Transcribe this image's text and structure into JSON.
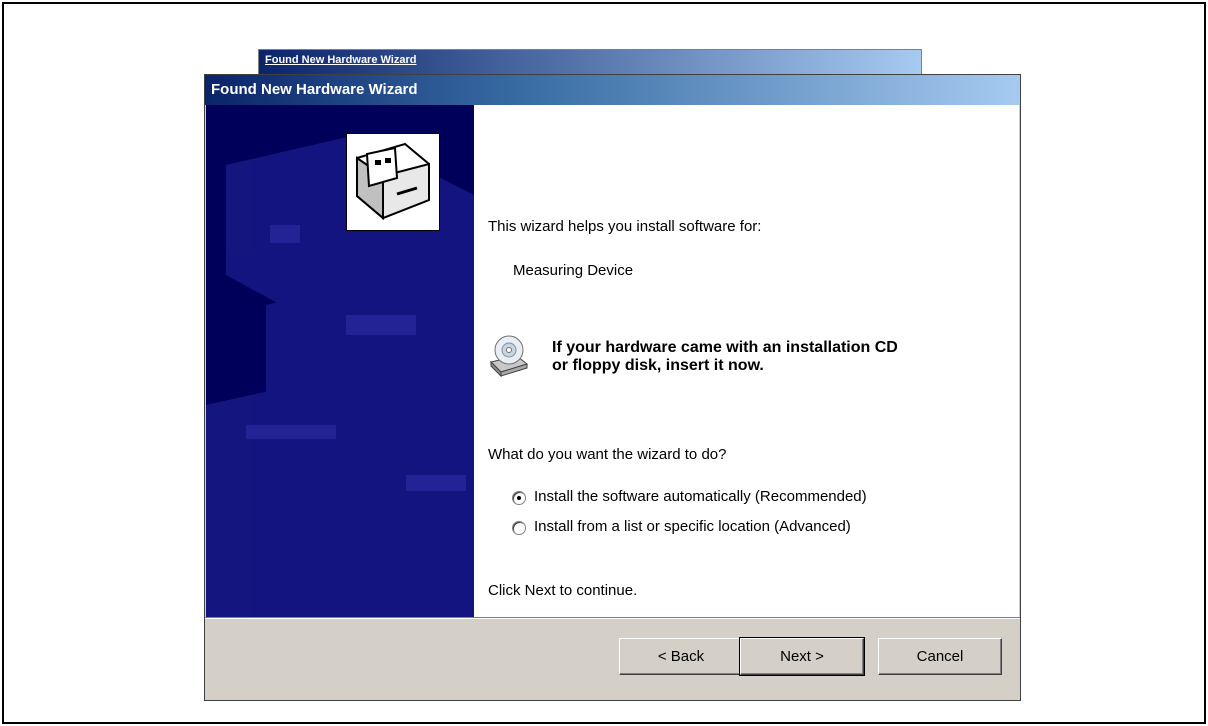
{
  "back_window": {
    "title": "Found New Hardware Wizard"
  },
  "window": {
    "title": "Found New Hardware Wizard"
  },
  "content": {
    "intro": "This wizard helps you install software for:",
    "device_name": "Measuring Device",
    "cd_notice_line1": "If your hardware came with an installation CD",
    "cd_notice_line2": "or floppy disk, insert it now.",
    "question": "What do you want the wizard to do?",
    "options": [
      {
        "label": "Install the software automatically (Recommended)",
        "selected": true
      },
      {
        "label": "Install from a list or specific location (Advanced)",
        "selected": false
      }
    ],
    "footer_hint": "Click Next to continue."
  },
  "buttons": {
    "back": "< Back",
    "next": "Next >",
    "cancel": "Cancel"
  },
  "icons": {
    "hardware": "hardware-card-icon",
    "cd": "cd-drive-icon"
  },
  "colors": {
    "banner": "#00005a",
    "title_start": "#0a246a",
    "title_end": "#a6caf0",
    "dialog_face": "#d4d0c8"
  }
}
